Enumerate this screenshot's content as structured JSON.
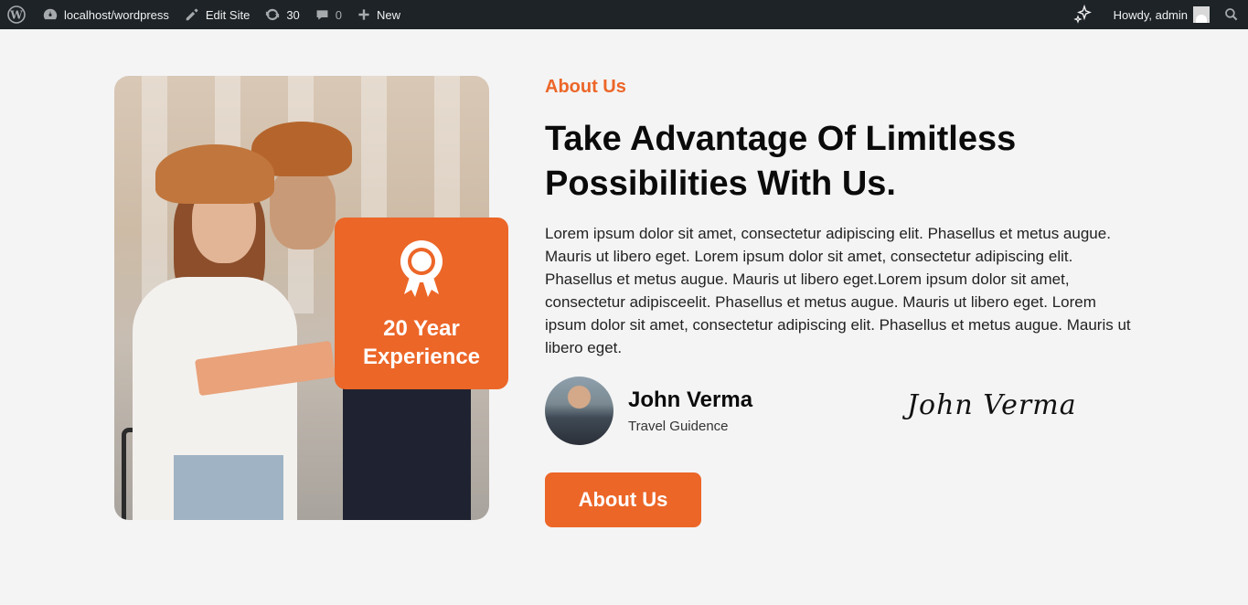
{
  "adminbar": {
    "site": "localhost/wordpress",
    "edit_site": "Edit Site",
    "updates_count": "30",
    "comments_count": "0",
    "new_label": "New",
    "howdy": "Howdy, admin"
  },
  "about": {
    "eyebrow": "About Us",
    "heading": "Take Advantage Of Limitless Possibilities With Us.",
    "paragraph": "Lorem ipsum dolor sit amet, consectetur adipiscing elit. Phasellus et metus augue. Mauris ut libero eget. Lorem ipsum dolor sit amet, consectetur adipiscing elit. Phasellus et metus augue. Mauris ut libero eget.Lorem ipsum dolor sit amet, consectetur adipisceelit. Phasellus et metus augue. Mauris ut libero eget. Lorem ipsum dolor sit amet, consectetur adipiscing elit. Phasellus et metus augue. Mauris ut libero eget.",
    "badge_line1": "20 Year",
    "badge_line2": "Experience",
    "author_name": "John Verma",
    "author_role": "Travel Guidence",
    "signature": "John Verma",
    "cta": "About Us"
  },
  "colors": {
    "accent": "#ec6628",
    "adminbar_bg": "#1d2327",
    "page_bg": "#f4f4f4"
  },
  "icons": [
    "wordpress-icon",
    "dashboard-icon",
    "edit-icon",
    "updates-icon",
    "comments-icon",
    "plus-icon",
    "sparkle-icon",
    "search-icon",
    "award-icon"
  ]
}
